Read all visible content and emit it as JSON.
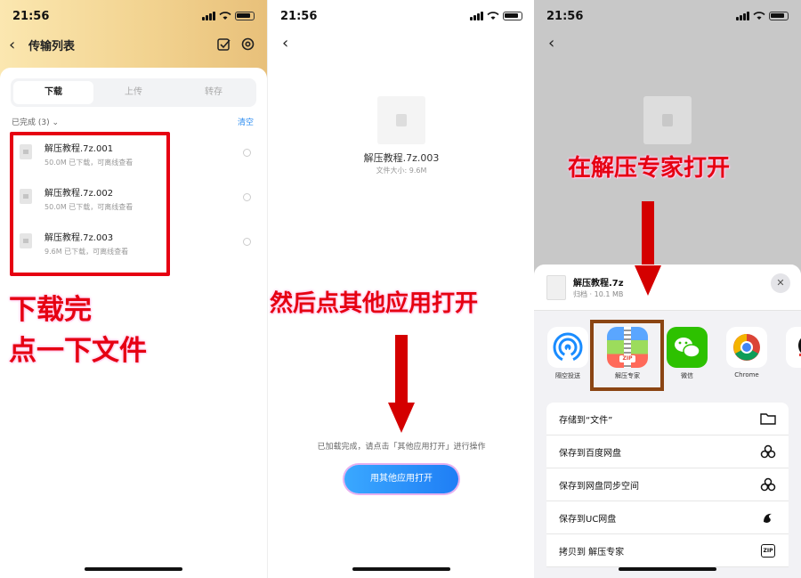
{
  "status": {
    "time": "21:56"
  },
  "panel1": {
    "title": "传输列表",
    "tabs": [
      "下载",
      "上传",
      "转存"
    ],
    "completed_label": "已完成 (3)",
    "clear_label": "清空",
    "files": [
      {
        "name": "解压教程.7z.001",
        "meta": "50.0M  已下载，可离线查看"
      },
      {
        "name": "解压教程.7z.002",
        "meta": "50.0M  已下载，可离线查看"
      },
      {
        "name": "解压教程.7z.003",
        "meta": "9.6M  已下载，可离线查看"
      }
    ],
    "annotation_line1": "下载完",
    "annotation_line2": "点一下文件"
  },
  "panel2": {
    "file_name": "解压教程.7z.003",
    "file_size": "文件大小: 9.6M",
    "annotation": "然后点其他应用打开",
    "hint": "已加载完成，请点击「其他应用打开」进行操作",
    "open_button": "用其他应用打开"
  },
  "panel3": {
    "annotation": "在解压专家打开",
    "sheet_file_name": "解压教程.7z",
    "sheet_file_meta": "归档 · 10.1 MB",
    "apps": [
      {
        "label": "隔空投送",
        "icon": "airdrop-icon"
      },
      {
        "label": "解压专家",
        "icon": "zip-expert-icon"
      },
      {
        "label": "微信",
        "icon": "wechat-icon"
      },
      {
        "label": "Chrome",
        "icon": "chrome-icon"
      }
    ],
    "zip_app_badge": "ZIP",
    "actions": [
      {
        "label": "存储到“文件”",
        "icon": "folder-icon"
      },
      {
        "label": "保存到百度网盘",
        "icon": "baidu-netdisk-icon"
      },
      {
        "label": "保存到网盘同步空间",
        "icon": "baidu-netdisk-icon"
      },
      {
        "label": "保存到UC网盘",
        "icon": "uc-icon"
      },
      {
        "label": "拷贝到 解压专家",
        "icon": "zip-icon",
        "badge": "ZIP"
      }
    ]
  },
  "colors": {
    "annotation_red": "#e60012",
    "accent_blue": "#2d8cf0",
    "highlight_brown": "#8b4513"
  }
}
